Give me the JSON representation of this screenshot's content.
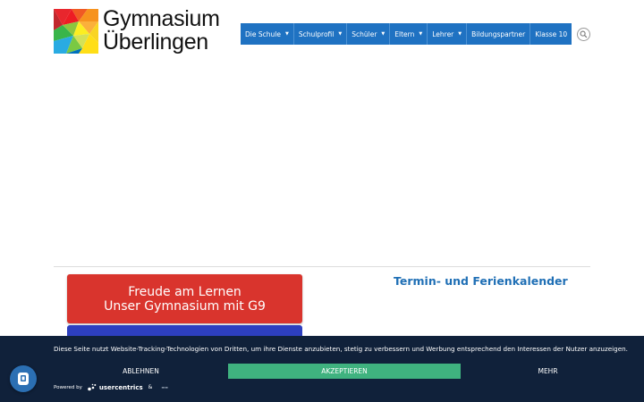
{
  "logo": {
    "line1": "Gymnasium",
    "line2": "Überlingen"
  },
  "nav": {
    "items": [
      {
        "label": "Die Schule",
        "has_dropdown": true
      },
      {
        "label": "Schulprofil",
        "has_dropdown": true
      },
      {
        "label": "Schüler",
        "has_dropdown": true
      },
      {
        "label": "Eltern",
        "has_dropdown": true
      },
      {
        "label": "Lehrer",
        "has_dropdown": true
      },
      {
        "label": "Bildungspartner",
        "has_dropdown": false
      },
      {
        "label": "Klasse 10",
        "has_dropdown": false
      }
    ],
    "caret": "▼",
    "color": "#1f72c2"
  },
  "search": {
    "icon": "search-icon"
  },
  "main": {
    "promo_button": {
      "line1": "Freude am Lernen",
      "line2": "Unser Gymnasium mit G9",
      "color": "#d9342d"
    },
    "second_button_color": "#2d3fbf",
    "calendar_title": "Termin- und Ferienkalender"
  },
  "cookie_banner": {
    "text": "Diese Seite nutzt Website-Tracking-Technologien von Dritten, um ihre Dienste anzubieten, stetig zu verbessern und Werbung entsprechend den Interessen der Nutzer anzuzeigen.",
    "deny_label": "ABLEHNEN",
    "accept_label": "AKZEPTIEREN",
    "more_label": "MEHR",
    "powered_by": "Powered by",
    "brand": "usercentrics",
    "amp": "&",
    "accept_color": "#3fb27f",
    "background": "#10213a"
  },
  "privacy_fab": {
    "icon": "privacy-settings-icon"
  }
}
